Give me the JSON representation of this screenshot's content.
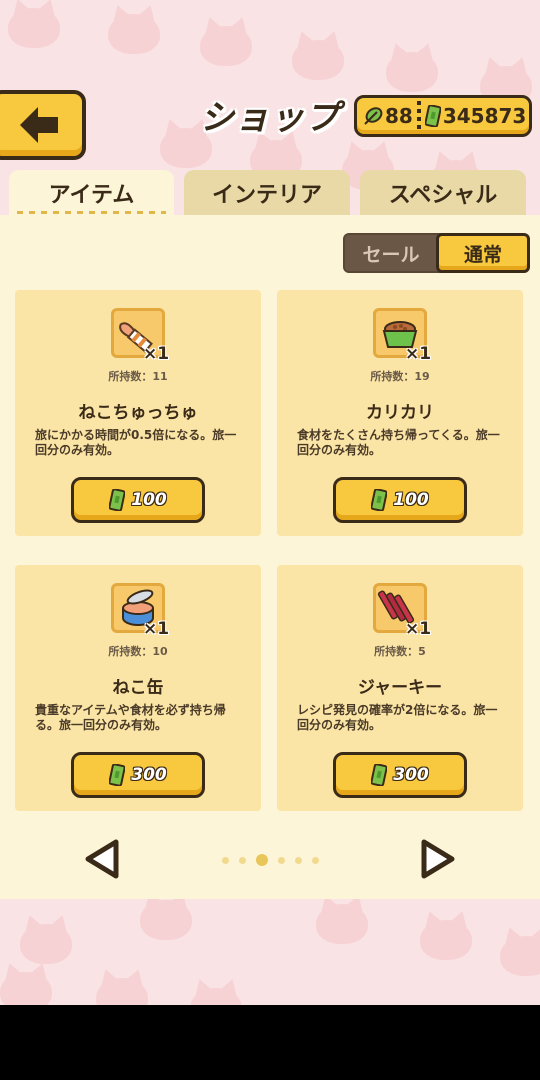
{
  "header": {
    "title": "ショップ",
    "leaves": "88",
    "money": "345873"
  },
  "tabs": [
    {
      "label": "アイテム",
      "active": true
    },
    {
      "label": "インテリア",
      "active": false
    },
    {
      "label": "スペシャル",
      "active": false
    }
  ],
  "toggle": {
    "sale": "セール",
    "normal": "通常",
    "selected": "通常"
  },
  "items": [
    {
      "icon": "treat-stick-icon",
      "qty": "×1",
      "owned": "所持数：11",
      "name": "ねこちゅっちゅ",
      "desc": "旅にかかる時間が0.5倍になる。旅一回分のみ有効。",
      "price": "100"
    },
    {
      "icon": "kibble-bowl-icon",
      "qty": "×1",
      "owned": "所持数：19",
      "name": "カリカリ",
      "desc": "食材をたくさん持ち帰ってくる。旅一回分のみ有効。",
      "price": "100"
    },
    {
      "icon": "cat-can-icon",
      "qty": "×1",
      "owned": "所持数：10",
      "name": "ねこ缶",
      "desc": "貴重なアイテムや食材を必ず持ち帰る。旅一回分のみ有効。",
      "price": "300"
    },
    {
      "icon": "jerky-icon",
      "qty": "×1",
      "owned": "所持数：5",
      "name": "ジャーキー",
      "desc": "レシピ発見の確率が2倍になる。旅一回分のみ有効。",
      "price": "300"
    }
  ],
  "pagination": {
    "pages": 6,
    "current": 2
  },
  "colors": {
    "accent": "#f8c93e",
    "outline": "#3a2a18",
    "panel": "#fdf5d8",
    "card": "#fbe5a6",
    "background": "#f9e3e4"
  }
}
